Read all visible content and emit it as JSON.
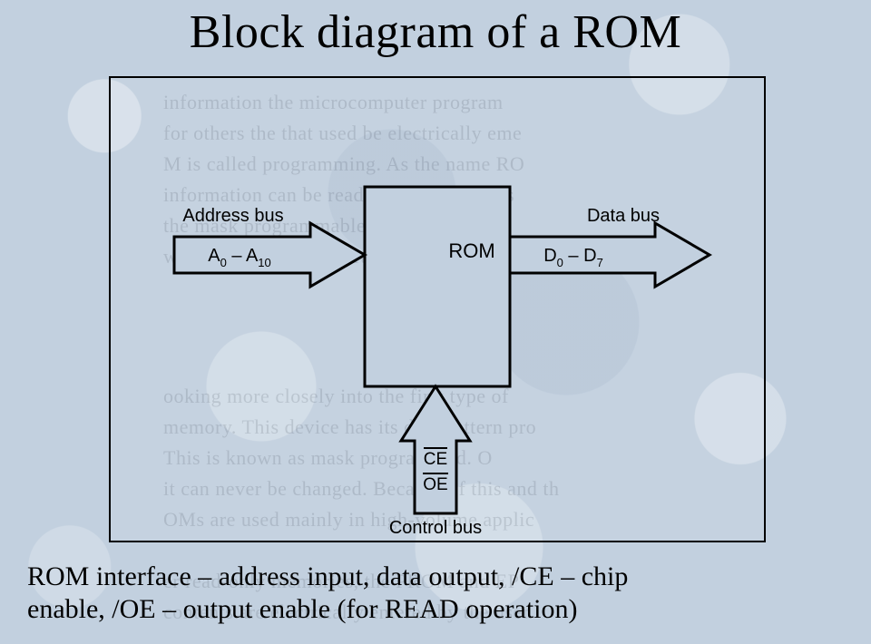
{
  "title": "Block diagram of a ROM",
  "diagram": {
    "block_label": "ROM",
    "address_bus": {
      "caption": "Address bus",
      "range_html": "A<sub>0</sub> – A<sub>10</sub>"
    },
    "data_bus": {
      "caption": "Data bus",
      "range_html": "D<sub>0</sub> – D<sub>7</sub>"
    },
    "control_bus": {
      "caption": "Control bus",
      "signals": [
        "CE",
        "OE"
      ]
    }
  },
  "caption_line1": "ROM interface – address input, data output, /CE – chip",
  "caption_line2": "enable, /OE – output enable (for READ operation)",
  "ghost_lines": [
    "information  the microcomputer  program",
    "for  others  the  that  used  be  electrically  eme",
    "M  is  called  programming.  As  the  name  RO",
    "information  can  be  read  only.  Three  types",
    "the  mask  programmable  read   ",
    "was  EPROM    and  the  erase   pros"
  ],
  "ghost_lines2": [
    "ooking  more  closely  into  the  first  type  of",
    "memory.  This  device  has  its  data  pattern  pro",
    "This  is  known  as  mask  programmed.  O",
    "it  can  never  be  changed.  Because  of  this  and  th",
    "OMs  are  used  mainly  in  high-volume  applic",
    "                                                ",
    "er  read-only  memories,  the  PROM  and  EP",
    "contents  are  electrically  entered  by  the  user"
  ]
}
